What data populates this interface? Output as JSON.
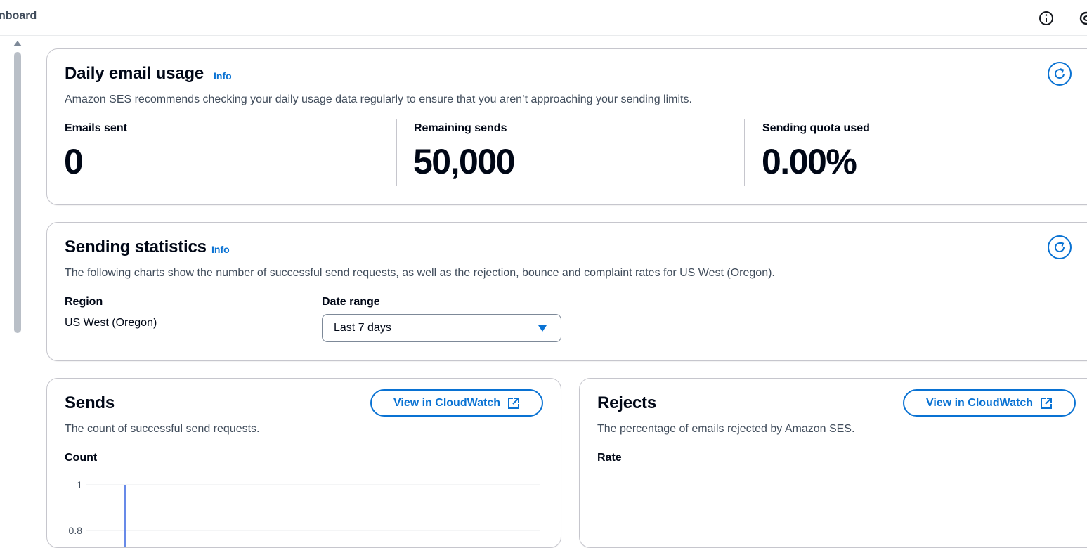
{
  "header": {
    "breadcrumb": "nboard",
    "icons": {
      "info": "info-circle-icon",
      "settings": "settings-icon"
    }
  },
  "colors": {
    "accent": "#0972d3",
    "text": "#000716",
    "muted": "#414d5c",
    "border": "#c6c6cd",
    "chart_line": "#688ae8"
  },
  "daily_usage": {
    "title": "Daily email usage",
    "info": "Info",
    "description": "Amazon SES recommends checking your daily usage data regularly to ensure that you aren’t approaching your sending limits.",
    "stats": [
      {
        "label": "Emails sent",
        "value": "0"
      },
      {
        "label": "Remaining sends",
        "value": "50,000"
      },
      {
        "label": "Sending quota used",
        "value": "0.00%"
      }
    ]
  },
  "sending_stats": {
    "title": "Sending statistics",
    "info": "Info",
    "description": "The following charts show the number of successful send requests, as well as the rejection, bounce and complaint rates for US West (Oregon).",
    "region_label": "Region",
    "region_value": "US West (Oregon)",
    "date_range_label": "Date range",
    "date_range_value": "Last 7 days"
  },
  "sends": {
    "title": "Sends",
    "button": "View in CloudWatch",
    "description": "The count of successful send requests.",
    "axis_label": "Count"
  },
  "rejects": {
    "title": "Rejects",
    "button": "View in CloudWatch",
    "description": "The percentage of emails rejected by Amazon SES.",
    "axis_label": "Rate"
  },
  "chart_data": {
    "type": "line",
    "ylabel": "Count",
    "yticks": [
      "1",
      "0.8"
    ],
    "ylim": [
      0,
      1
    ],
    "grid": true
  }
}
